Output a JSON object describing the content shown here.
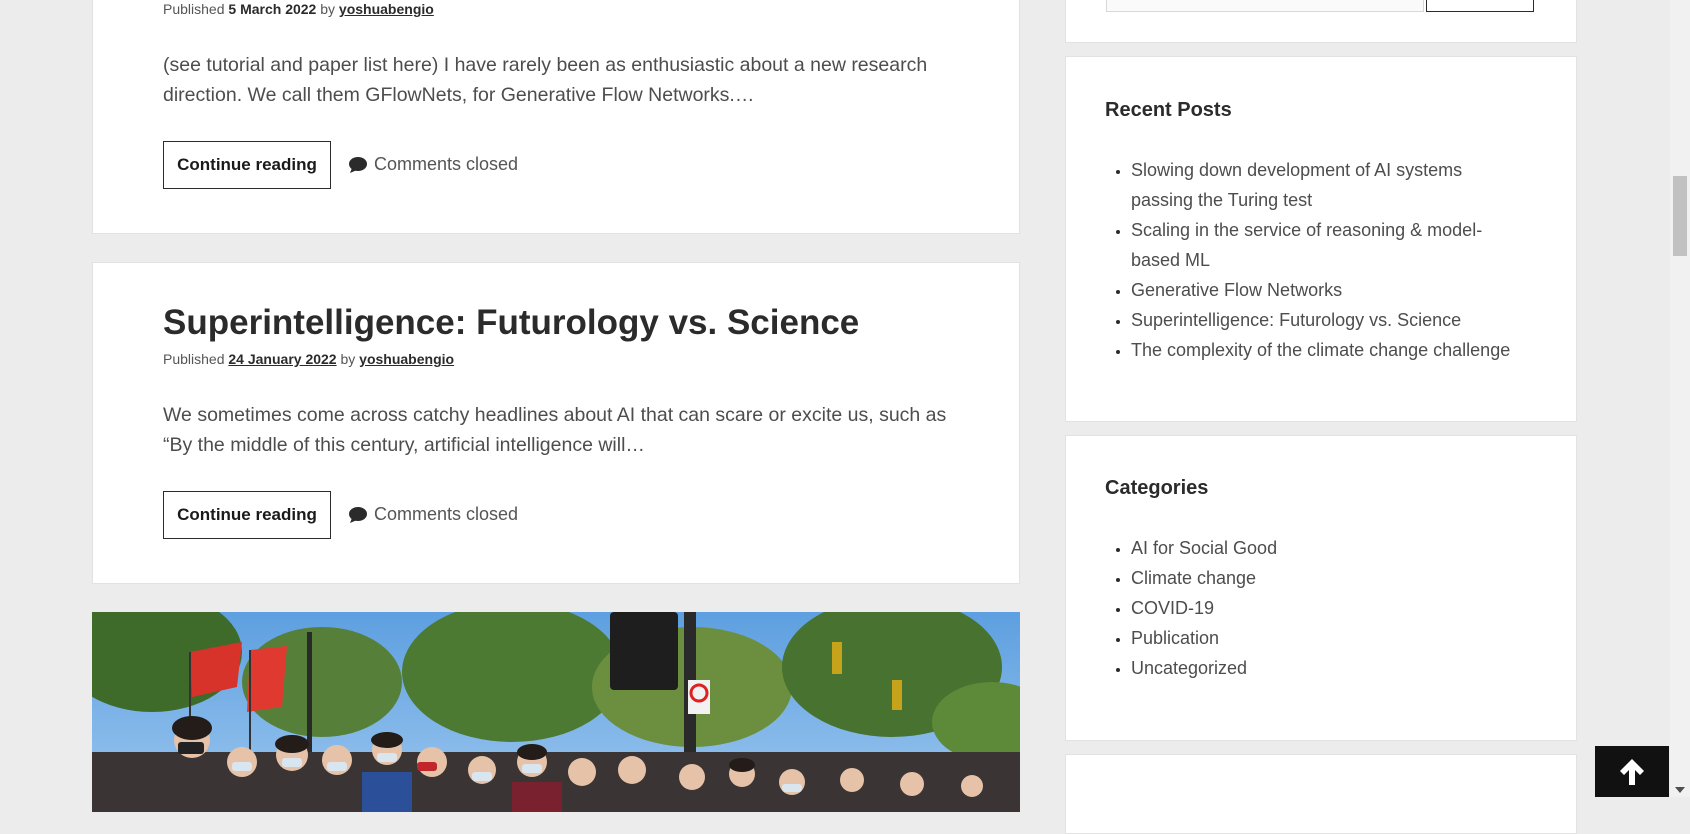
{
  "posts": [
    {
      "meta_prefix": "Published",
      "date": "5 March 2022",
      "by": "by",
      "author": "yoshuabengio",
      "excerpt": "(see tutorial and paper list here) I have rarely been as enthusiastic about a new research direction. We call them GFlowNets, for Generative Flow Networks.…",
      "continue_label": "Continue reading",
      "comments_label": "Comments closed"
    },
    {
      "title": "Superintelligence: Futurology vs. Science",
      "meta_prefix": "Published",
      "date": "24 January 2022",
      "by": "by",
      "author": "yoshuabengio",
      "excerpt": "We sometimes come across catchy headlines about AI that can scare or excite us, such as “By the middle of this century, artificial intelligence will…",
      "continue_label": "Continue reading",
      "comments_label": "Comments closed"
    }
  ],
  "sidebar": {
    "recent_posts": {
      "title": "Recent Posts",
      "items": [
        "Slowing down development of AI systems passing the Turing test",
        "Scaling in the service of reasoning & model-based ML",
        "Generative Flow Networks",
        "Superintelligence: Futurology vs. Science",
        "The complexity of the climate change challenge"
      ]
    },
    "categories": {
      "title": "Categories",
      "items": [
        "AI for Social Good",
        "Climate change",
        "COVID-19",
        "Publication",
        "Uncategorized"
      ]
    }
  },
  "icons": {
    "comments": "comment-bubble-icon",
    "back_to_top": "arrow-up-icon"
  },
  "colors": {
    "page_background": "#ececec",
    "card_background": "#ffffff",
    "text": "#2b2b2b",
    "back_to_top_bg": "#111111"
  }
}
